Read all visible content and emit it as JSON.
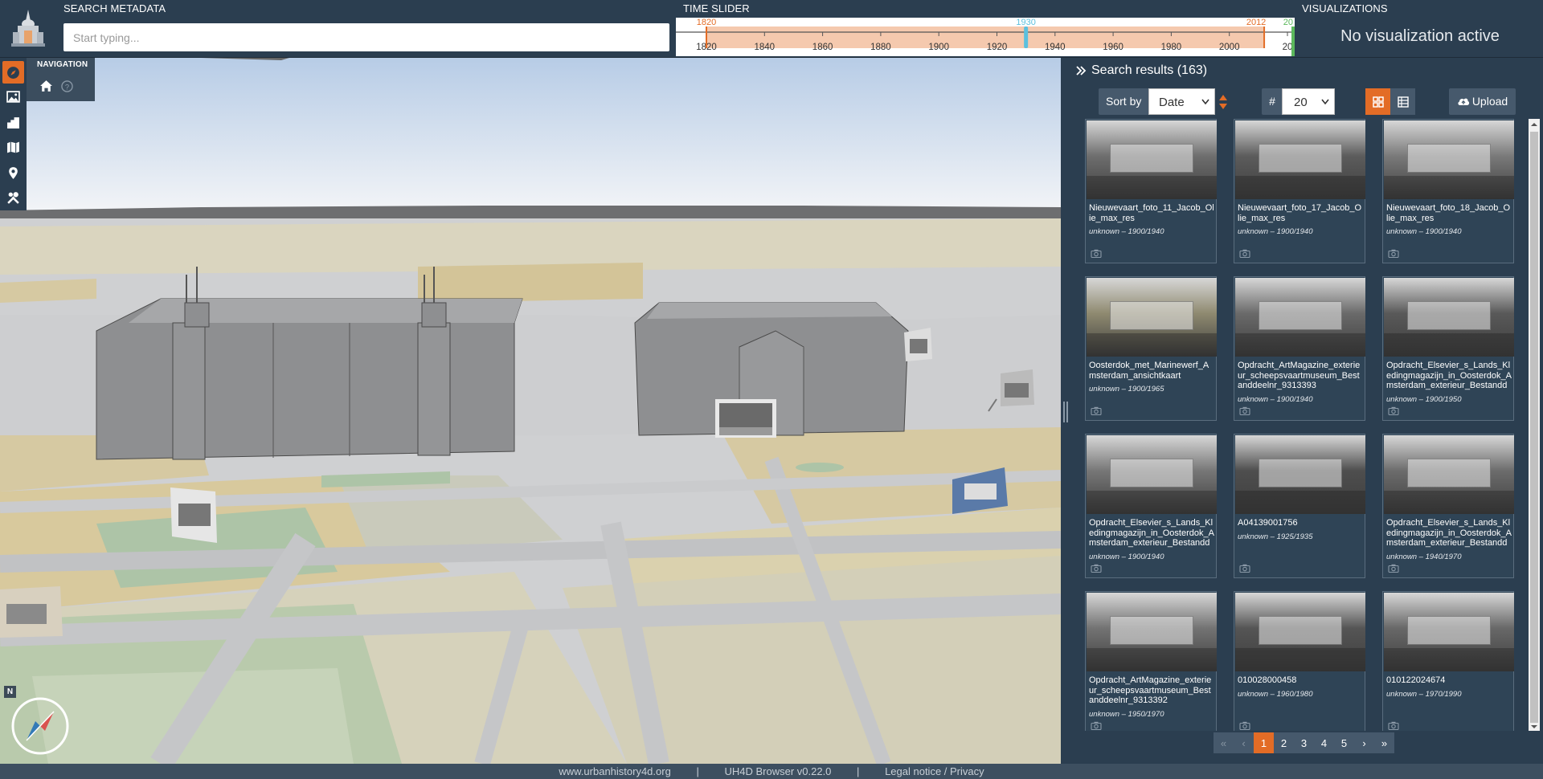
{
  "header": {
    "search_title": "SEARCH METADATA",
    "search_placeholder": "Start typing...",
    "timeslider_title": "TIME SLIDER",
    "visualizations_title": "VISUALIZATIONS",
    "visualizations_message": "No visualization active"
  },
  "timeslider": {
    "start_label": "1820",
    "current_label": "1930",
    "end_label": "2012",
    "cut_label": "20",
    "ticks": [
      "1820",
      "1840",
      "1860",
      "1880",
      "1900",
      "1920",
      "1940",
      "1960",
      "1980",
      "2000",
      "20"
    ],
    "range_color": "#f5c9ae",
    "range_border": "#e36c26",
    "current_color": "#5bc0de"
  },
  "toolbar": {
    "icons": [
      "compass-icon",
      "image-icon",
      "buildings-icon",
      "map-icon",
      "map-marker-icon",
      "tools-icon"
    ],
    "active": "compass-icon"
  },
  "navigation": {
    "title": "NAVIGATION",
    "icons": [
      "home-icon",
      "help-icon"
    ]
  },
  "compass": {
    "north_label": "N"
  },
  "results": {
    "title": "Search results (163)",
    "sort_label": "Sort by",
    "sort_value": "Date",
    "count_label": "#",
    "page_size": "20",
    "upload_label": "Upload",
    "items": [
      {
        "title": "Nieuwevaart_foto_11_Jacob_Olie_max_res",
        "date": "unknown – 1900/1940"
      },
      {
        "title": "Nieuwevaart_foto_17_Jacob_Olie_max_res",
        "date": "unknown – 1900/1940"
      },
      {
        "title": "Nieuwevaart_foto_18_Jacob_Olie_max_res",
        "date": "unknown – 1900/1940"
      },
      {
        "title": "Oosterdok_met_Marinewerf_Amsterdam_ansichtkaart",
        "date": "unknown – 1900/1965"
      },
      {
        "title": "Opdracht_ArtMagazine_exterieur_scheepsvaartmuseum_Bestanddeelnr_9313393",
        "date": "unknown – 1900/1940"
      },
      {
        "title": "Opdracht_Elsevier_s_Lands_Kledingmagazijn_in_Oosterdok_Amsterdam_exterieur_Bestandde...",
        "date": "unknown – 1900/1950"
      },
      {
        "title": "Opdracht_Elsevier_s_Lands_Kledingmagazijn_in_Oosterdok_Amsterdam_exterieur_Bestandde...",
        "date": "unknown – 1900/1940"
      },
      {
        "title": "A04139001756",
        "date": "unknown – 1925/1935"
      },
      {
        "title": "Opdracht_Elsevier_s_Lands_Kledingmagazijn_in_Oosterdok_Amsterdam_exterieur_Bestandde...",
        "date": "unknown – 1940/1970"
      },
      {
        "title": "Opdracht_ArtMagazine_exterieur_scheepsvaartmuseum_Bestanddeelnr_9313392",
        "date": "unknown – 1950/1970"
      },
      {
        "title": "010028000458",
        "date": "unknown – 1960/1980"
      },
      {
        "title": "010122024674",
        "date": "unknown – 1970/1990"
      }
    ]
  },
  "pagination": {
    "first": "«",
    "prev": "‹",
    "pages": [
      "1",
      "2",
      "3",
      "4",
      "5"
    ],
    "active": "1",
    "next": "›",
    "last": "»"
  },
  "footer": {
    "site": "www.urbanhistory4d.org",
    "sep1": "|",
    "version": "UH4D Browser v0.22.0",
    "sep2": "|",
    "legal": "Legal notice / Privacy"
  }
}
